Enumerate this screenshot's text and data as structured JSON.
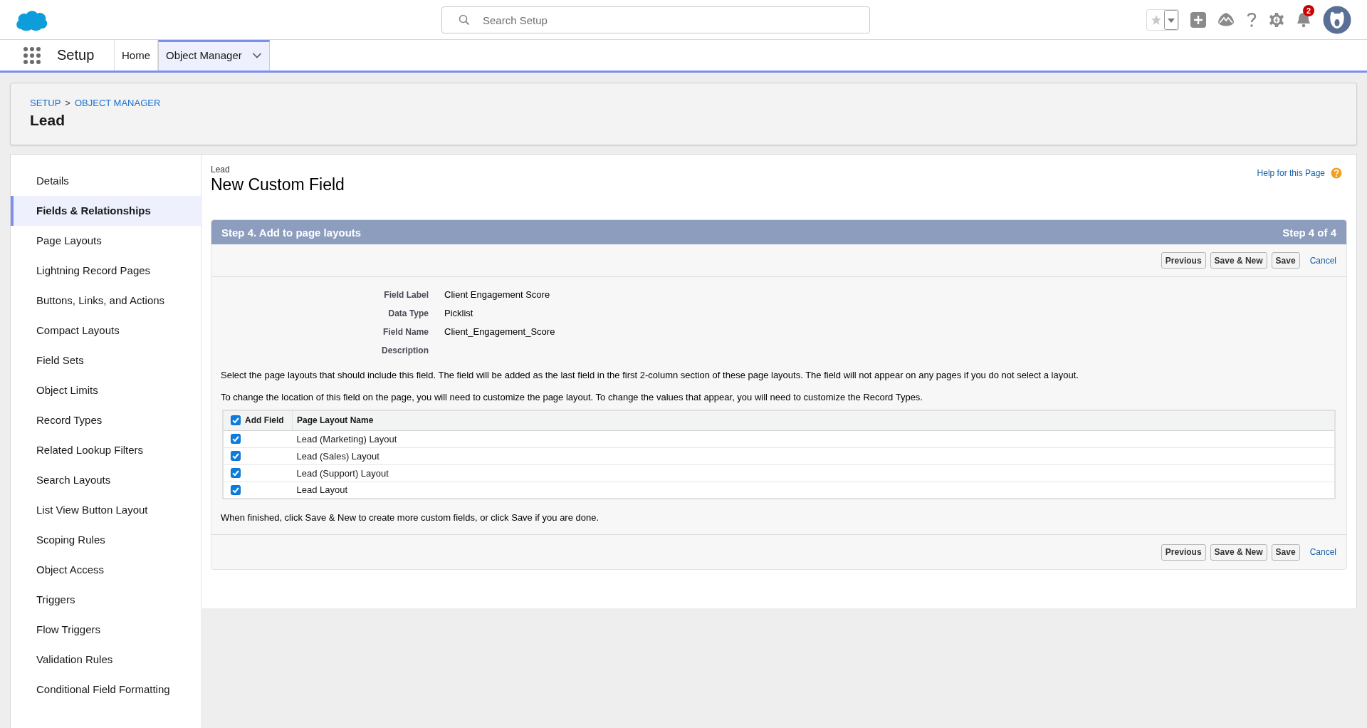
{
  "global_header": {
    "search": {
      "placeholder": "Search Setup"
    },
    "notification_count": "2"
  },
  "nav": {
    "app_name": "Setup",
    "tabs": [
      {
        "label": "Home",
        "selected": false,
        "dropdown": false
      },
      {
        "label": "Object Manager",
        "selected": true,
        "dropdown": true
      }
    ]
  },
  "page_header": {
    "breadcrumb": [
      {
        "label": "SETUP"
      },
      {
        "label": "OBJECT MANAGER"
      }
    ],
    "separator": ">",
    "title": "Lead"
  },
  "sidebar": {
    "items": [
      {
        "label": "Details",
        "selected": false
      },
      {
        "label": "Fields & Relationships",
        "selected": true
      },
      {
        "label": "Page Layouts",
        "selected": false
      },
      {
        "label": "Lightning Record Pages",
        "selected": false
      },
      {
        "label": "Buttons, Links, and Actions",
        "selected": false
      },
      {
        "label": "Compact Layouts",
        "selected": false
      },
      {
        "label": "Field Sets",
        "selected": false
      },
      {
        "label": "Object Limits",
        "selected": false
      },
      {
        "label": "Record Types",
        "selected": false
      },
      {
        "label": "Related Lookup Filters",
        "selected": false
      },
      {
        "label": "Search Layouts",
        "selected": false
      },
      {
        "label": "List View Button Layout",
        "selected": false
      },
      {
        "label": "Scoping Rules",
        "selected": false
      },
      {
        "label": "Object Access",
        "selected": false
      },
      {
        "label": "Triggers",
        "selected": false
      },
      {
        "label": "Flow Triggers",
        "selected": false
      },
      {
        "label": "Validation Rules",
        "selected": false
      },
      {
        "label": "Conditional Field Formatting",
        "selected": false
      }
    ]
  },
  "content": {
    "object_name": "Lead",
    "title": "New Custom Field",
    "help_link": "Help for this Page",
    "step": {
      "title": "Step 4. Add to page layouts",
      "counter": "Step 4 of 4"
    },
    "top_actions": {
      "buttons": [
        "Previous",
        "Save & New",
        "Save"
      ],
      "cancel": "Cancel"
    },
    "fields": [
      {
        "label": "Field Label",
        "value": "Client Engagement Score"
      },
      {
        "label": "Data Type",
        "value": "Picklist"
      },
      {
        "label": "Field Name",
        "value": "Client_Engagement_Score"
      },
      {
        "label": "Description"
      }
    ],
    "instructions": [
      "Select the page layouts that should include this field. The field will be added as the last field in the first 2-column section of these page layouts. The field will not appear on any pages if you do not select a layout.",
      "To change the location of this field on the page, you will need to customize the page layout. To change the values that appear, you will need to customize the Record Types."
    ],
    "layouts_table": {
      "columns": [
        "Add Field",
        "Page Layout Name"
      ],
      "all_checked": true,
      "rows": [
        {
          "checked": true,
          "name": "Lead (Marketing) Layout"
        },
        {
          "checked": true,
          "name": "Lead (Sales) Layout"
        },
        {
          "checked": true,
          "name": "Lead (Support) Layout"
        },
        {
          "checked": true,
          "name": "Lead Layout"
        }
      ]
    },
    "finish_note": "When finished, click Save & New to create more custom fields, or click Save if you are done.",
    "bottom_actions": {
      "buttons": [
        "Previous",
        "Save & New",
        "Save"
      ],
      "cancel": "Cancel"
    }
  }
}
